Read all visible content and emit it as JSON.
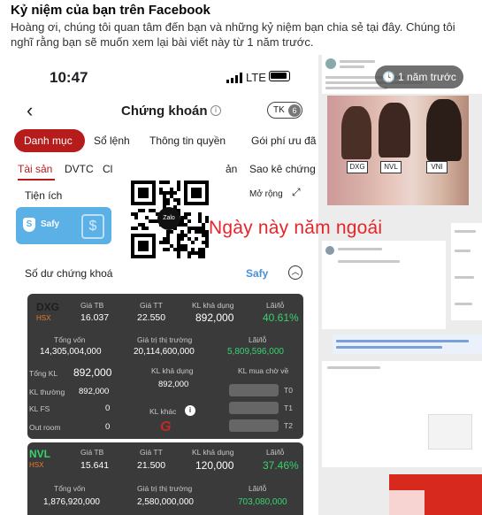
{
  "memory": {
    "title": "Kỷ niệm của bạn trên Facebook",
    "description": "Hoàng ơi, chúng tôi quan tâm đến bạn và những kỷ niệm bạn chia sẻ tại đây. Chúng tôi nghĩ rằng bạn sẽ muốn xem lại bài viết này từ 1 năm trước.",
    "ago": "1 năm trước"
  },
  "status_bar": {
    "time": "10:47",
    "network": "LTE"
  },
  "app": {
    "title": "Chứng khoán",
    "account": "TK",
    "account_num": "6",
    "tabs": [
      "Danh mục",
      "Sổ lệnh",
      "Thông tin quyền",
      "Gói phí ưu đã"
    ],
    "subtabs": [
      "Tài sản",
      "DVTC",
      "Cl",
      "ản",
      "Sao kê chứng"
    ],
    "utility": "Tiện ích",
    "expand": "Mở rộng",
    "safy_label": "Safy",
    "balance_label": "Số dư chứng khoá",
    "safy_toggle": "Safy"
  },
  "caption": "Ngày này năm ngoái",
  "holdings": [
    {
      "symbol": "DXG",
      "exchange": "HSX",
      "avg_label": "Giá TB",
      "avg": "16.037",
      "price_label": "Giá TT",
      "price": "22.550",
      "avail_label": "KL khả dụng",
      "avail": "892,000",
      "pl_label": "Lãi/lỗ",
      "pl_pct": "40.61%",
      "cost_label": "Tổng vốn",
      "cost": "14,305,004,000",
      "mkt_label": "Giá trị thị trường",
      "mkt": "20,114,600,000",
      "pl_abs_label": "Lãi/lỗ",
      "pl_abs": "5,809,596,000",
      "total_kl_label": "Tổng KL",
      "total_kl": "892,000",
      "avail2_label": "KL khả dụng",
      "avail2": "892,000",
      "pending_label": "KL mua chờ về",
      "normal_label": "KL thường",
      "normal": "892,000",
      "fs_label": "KL FS",
      "fs": "0",
      "other_label": "KL khác",
      "out_label": "Out room",
      "out": "0",
      "t_labels": [
        "T0",
        "T1",
        "T2"
      ]
    },
    {
      "symbol": "NVL",
      "exchange": "HSX",
      "avg_label": "Giá TB",
      "avg": "15.641",
      "price_label": "Giá TT",
      "price": "21.500",
      "avail_label": "KL khả dụng",
      "avail": "120,000",
      "pl_label": "Lãi/lỗ",
      "pl_pct": "37.46%",
      "cost_label": "Tổng vốn",
      "cost": "1,876,920,000",
      "mkt_label": "Giá trị thị trường",
      "mkt": "2,580,000,000",
      "pl_abs_label": "Lãi/lỗ",
      "pl_abs": "703,080,000"
    }
  ],
  "thumb_labels": [
    "DXG",
    "NVL",
    "VNI"
  ],
  "qr_center": "Zalo",
  "colors": {
    "accent": "#b71c1c",
    "gain": "#36d36d",
    "caption": "#e5252a"
  }
}
